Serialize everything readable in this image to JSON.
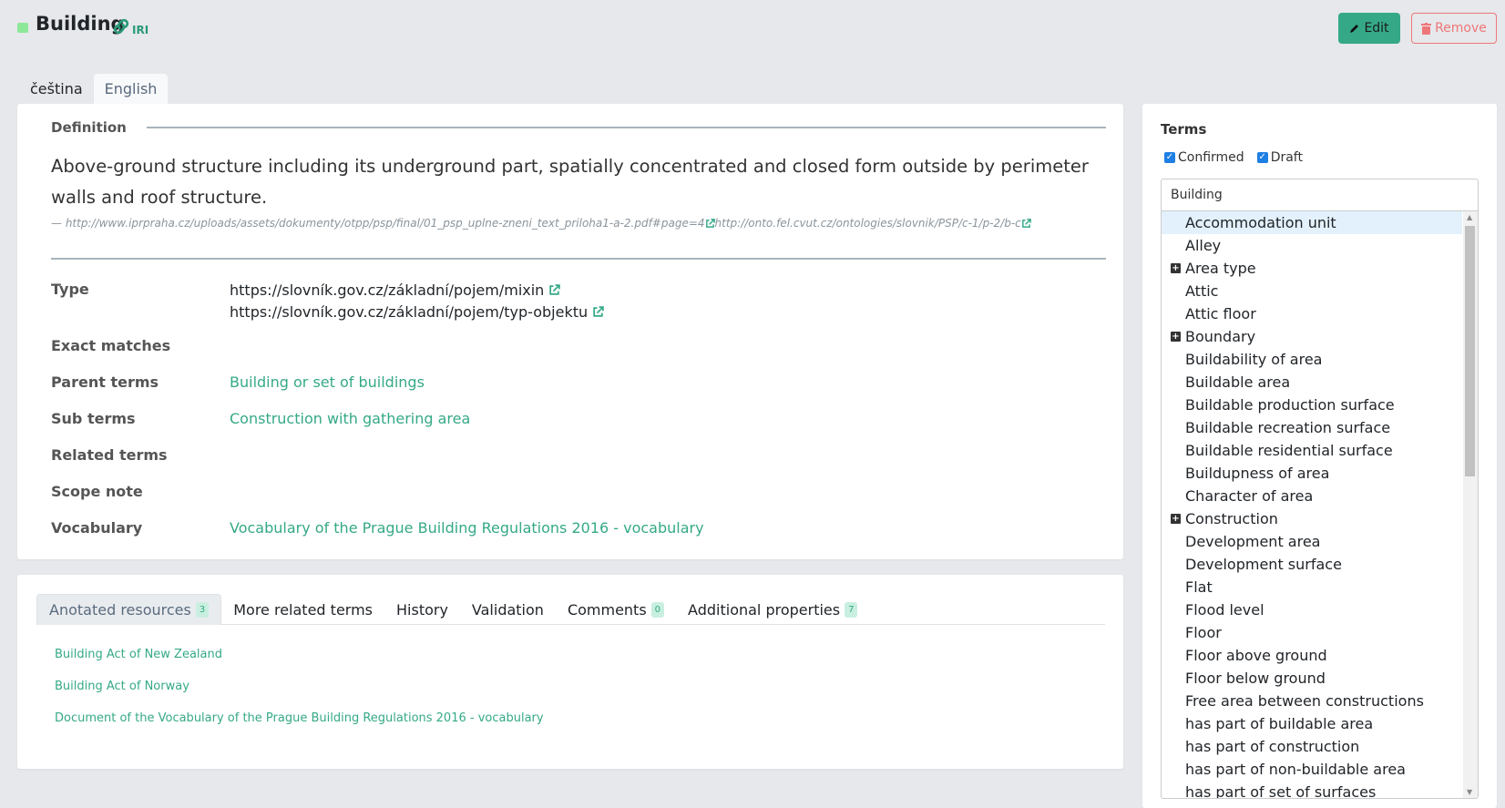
{
  "header": {
    "title": "Building",
    "iri_label": "IRI",
    "edit_label": "Edit",
    "remove_label": "Remove"
  },
  "language_tabs": [
    {
      "label": "čeština",
      "active": false
    },
    {
      "label": "English",
      "active": true
    }
  ],
  "definition": {
    "label": "Definition",
    "text": "Above-ground structure including its underground part, spatially concentrated and closed form outside by perimeter walls and roof structure.",
    "source_prefix": "—",
    "sources": [
      "http://www.iprpraha.cz/uploads/assets/dokumenty/otpp/psp/final/01_psp_uplne-zneni_text_priloha1-a-2.pdf#page=4",
      "http://onto.fel.cvut.cz/ontologies/slovnik/PSP/c-1/p-2/b-c"
    ]
  },
  "properties": {
    "type_label": "Type",
    "types": [
      "https://slovník.gov.cz/základní/pojem/mixin",
      "https://slovník.gov.cz/základní/pojem/typ-objektu"
    ],
    "exact_matches_label": "Exact matches",
    "parent_terms_label": "Parent terms",
    "parent_terms": "Building or set of buildings",
    "sub_terms_label": "Sub terms",
    "sub_terms": "Construction with gathering area",
    "related_terms_label": "Related terms",
    "scope_note_label": "Scope note",
    "vocabulary_label": "Vocabulary",
    "vocabulary": "Vocabulary of the Prague Building Regulations 2016 - vocabulary"
  },
  "resource_tabs": [
    {
      "label": "Anotated resources",
      "badge": "3",
      "active": true
    },
    {
      "label": "More related terms",
      "badge": null
    },
    {
      "label": "History",
      "badge": null
    },
    {
      "label": "Validation",
      "badge": null
    },
    {
      "label": "Comments",
      "badge": "0"
    },
    {
      "label": "Additional properties",
      "badge": "7"
    }
  ],
  "annotated_resources": [
    "Building Act of New Zealand",
    "Building Act of Norway",
    "Document of the Vocabulary of the Prague Building Regulations 2016 - vocabulary"
  ],
  "terms_panel": {
    "title": "Terms",
    "filters": [
      {
        "label": "Confirmed",
        "checked": true
      },
      {
        "label": "Draft",
        "checked": true
      }
    ],
    "search_value": "Building",
    "items": [
      {
        "label": "Accommodation unit",
        "expandable": false,
        "selected": true
      },
      {
        "label": "Alley",
        "expandable": false
      },
      {
        "label": "Area type",
        "expandable": true
      },
      {
        "label": "Attic",
        "expandable": false
      },
      {
        "label": "Attic floor",
        "expandable": false
      },
      {
        "label": "Boundary",
        "expandable": true
      },
      {
        "label": "Buildability of area",
        "expandable": false
      },
      {
        "label": "Buildable area",
        "expandable": false
      },
      {
        "label": "Buildable production surface",
        "expandable": false
      },
      {
        "label": "Buildable recreation surface",
        "expandable": false
      },
      {
        "label": "Buildable residential surface",
        "expandable": false
      },
      {
        "label": "Buildupness of area",
        "expandable": false
      },
      {
        "label": "Character of area",
        "expandable": false
      },
      {
        "label": "Construction",
        "expandable": true
      },
      {
        "label": "Development area",
        "expandable": false
      },
      {
        "label": "Development surface",
        "expandable": false
      },
      {
        "label": "Flat",
        "expandable": false
      },
      {
        "label": "Flood level",
        "expandable": false
      },
      {
        "label": "Floor",
        "expandable": false
      },
      {
        "label": "Floor above ground",
        "expandable": false
      },
      {
        "label": "Floor below ground",
        "expandable": false
      },
      {
        "label": "Free area between constructions",
        "expandable": false
      },
      {
        "label": "has part of buildable area",
        "expandable": false
      },
      {
        "label": "has part of construction",
        "expandable": false
      },
      {
        "label": "has part of non-buildable area",
        "expandable": false
      },
      {
        "label": "has part of set of surfaces",
        "expandable": false
      }
    ]
  },
  "colors": {
    "accent": "#35a987",
    "danger": "#ef7678",
    "status": "#8ee89a"
  }
}
